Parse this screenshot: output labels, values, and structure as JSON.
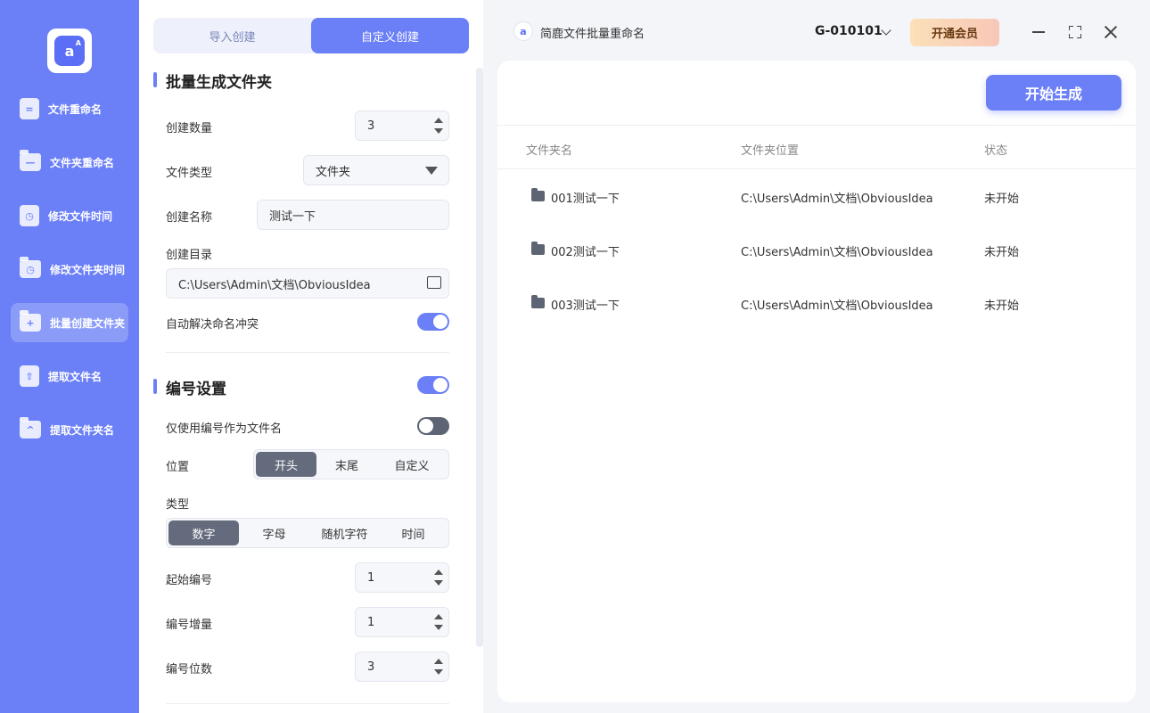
{
  "sidebar": {
    "logo": "a",
    "logo_small": "A",
    "items": [
      {
        "label": "文件重命名",
        "icon": "file-icon",
        "icon_glyph": "="
      },
      {
        "label": "文件夹重命名",
        "icon": "folder-icon",
        "icon_glyph": "—"
      },
      {
        "label": "修改文件时间",
        "icon": "file-clock-icon",
        "icon_glyph": "◷"
      },
      {
        "label": "修改文件夹时间",
        "icon": "folder-clock-icon",
        "icon_glyph": "◷"
      },
      {
        "label": "批量创建文件夹",
        "icon": "folder-add-icon",
        "icon_glyph": "+"
      },
      {
        "label": "提取文件名",
        "icon": "file-upload-icon",
        "icon_glyph": "⇧"
      },
      {
        "label": "提取文件夹名",
        "icon": "folder-upload-icon",
        "icon_glyph": "^"
      }
    ],
    "active_index": 4
  },
  "mode_tabs": [
    "导入创建",
    "自定义创建"
  ],
  "active_mode": 1,
  "section1": {
    "title": "批量生成文件夹",
    "count_label": "创建数量",
    "count_value": "3",
    "type_label": "文件类型",
    "type_value": "文件夹",
    "name_label": "创建名称",
    "name_value": "测试一下",
    "dir_label": "创建目录",
    "dir_value": "C:\\Users\\Admin\\文档\\ObviousIdea",
    "conflict_label": "自动解决命名冲突",
    "conflict_on": true
  },
  "section2": {
    "title": "编号设置",
    "enabled": true,
    "only_number_label": "仅使用编号作为文件名",
    "only_number_on": false,
    "position_label": "位置",
    "position_options": [
      "开头",
      "末尾",
      "自定义"
    ],
    "position_selected": 0,
    "type_label": "类型",
    "type_options": [
      "数字",
      "字母",
      "随机字符",
      "时间"
    ],
    "type_selected": 0,
    "start_label": "起始编号",
    "start_value": "1",
    "step_label": "编号增量",
    "step_value": "1",
    "digits_label": "编号位数",
    "digits_value": "3"
  },
  "titlebar": {
    "app_icon": "a",
    "app_title": "简鹿文件批量重命名",
    "account": "G-010101",
    "vip_label": "开通会员"
  },
  "main": {
    "start_button": "开始生成",
    "columns": [
      "文件夹名",
      "文件夹位置",
      "状态"
    ],
    "rows": [
      {
        "name": "001测试一下",
        "path": "C:\\Users\\Admin\\文档\\ObviousIdea",
        "status": "未开始"
      },
      {
        "name": "002测试一下",
        "path": "C:\\Users\\Admin\\文档\\ObviousIdea",
        "status": "未开始"
      },
      {
        "name": "003测试一下",
        "path": "C:\\Users\\Admin\\文档\\ObviousIdea",
        "status": "未开始"
      }
    ]
  },
  "colors": {
    "accent": "#6b7ff7",
    "sidebar": "#6b7ff7",
    "dark_chip": "#646b7c",
    "vip_text": "#6a3a12"
  }
}
